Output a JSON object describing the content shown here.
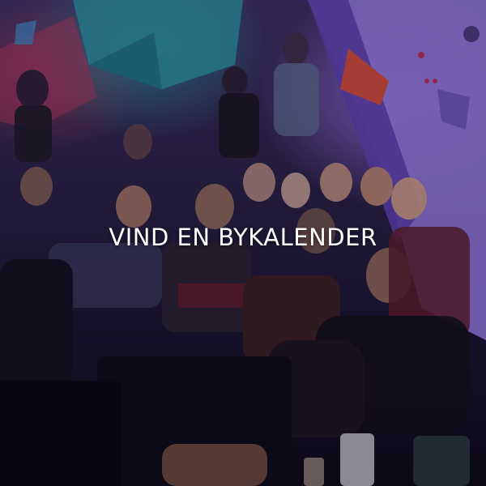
{
  "card": {
    "headline": "VIND EN BYKALENDER"
  },
  "colors": {
    "text": "#ffffff",
    "wall_purple": "#8a6fd6",
    "holds_teal": "#2b9aa5",
    "holds_red": "#b53a58"
  }
}
